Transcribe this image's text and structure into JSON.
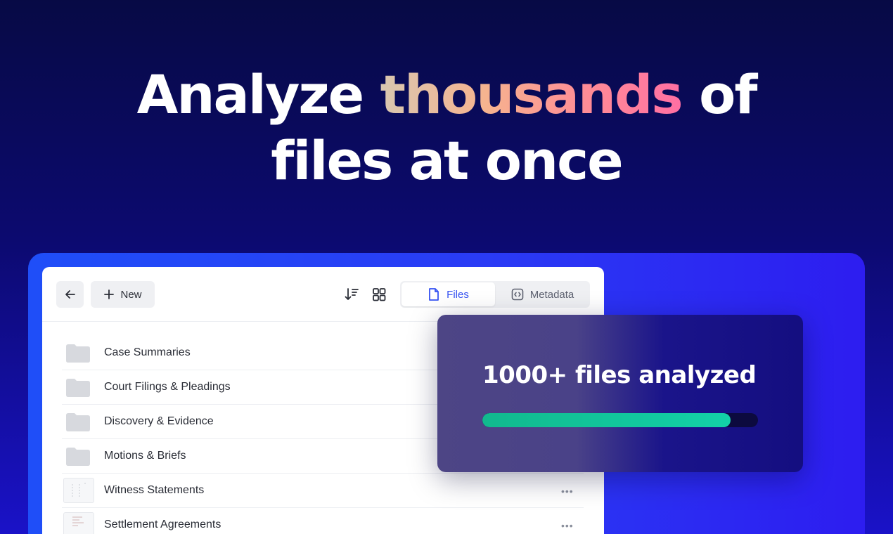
{
  "headline": {
    "line1_pre": "Analyze ",
    "line1_highlight": "thousands",
    "line1_post": " of",
    "line2": "files at once"
  },
  "toolbar": {
    "new_label": "New",
    "tabs": [
      {
        "label": "Files",
        "active": true
      },
      {
        "label": "Metadata",
        "active": false
      }
    ]
  },
  "files": [
    {
      "name": "Case Summaries",
      "type": "folder"
    },
    {
      "name": "Court Filings & Pleadings",
      "type": "folder"
    },
    {
      "name": "Discovery & Evidence",
      "type": "folder"
    },
    {
      "name": "Motions & Briefs",
      "type": "folder"
    },
    {
      "name": "Witness Statements",
      "type": "document",
      "menu": "•••"
    },
    {
      "name": "Settlement Agreements",
      "type": "document",
      "menu": "•••"
    }
  ],
  "analysis": {
    "title": "1000+ files analyzed",
    "progress_fraction": 0.9
  },
  "colors": {
    "accent": "#3552f2",
    "progress": "#13d1a8",
    "highlight_gradient": [
      "#d9c7b0",
      "#f6b38f",
      "#ff8a96",
      "#ff6fa3"
    ]
  },
  "icons": {
    "back": "arrow-left-icon",
    "new": "plus-icon",
    "sort": "sort-descending-icon",
    "grid": "grid-view-icon",
    "files_tab": "file-icon",
    "metadata_tab": "code-brackets-icon",
    "folder": "folder-icon",
    "row_menu": "more-horizontal-icon"
  }
}
